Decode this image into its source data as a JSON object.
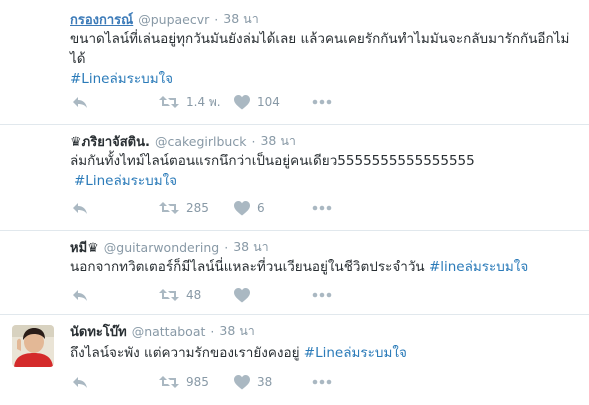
{
  "colors": {
    "hashtag": "#2b7bb9",
    "name_link": "#3b7ab8",
    "muted": "#8899a6",
    "icon": "#aab8c2",
    "divider": "#e1e8ed"
  },
  "icons": [
    "reply-icon",
    "retweet-icon",
    "like-icon",
    "more-icon"
  ],
  "tweets": [
    {
      "display_name": "กรองการณ์",
      "handle": "@pupaecvr",
      "sep": "·",
      "time": "38 นา",
      "text_line1": "ขนาดไลน์ที่เล่นอยู่ทุกวันมันยังล่มได้เลย แล้วคนเคยรักกันทำไมมันจะกลับมารักกันอีกไม่",
      "text_line2": "ได้",
      "hashtag": "#Lineล่มระบมใจ",
      "retweets": "1.4 พ.",
      "likes": "104"
    },
    {
      "display_name": "♛ภริยาจัสติน.",
      "handle": "@cakegirlbuck",
      "sep": "·",
      "time": "38 นา",
      "text": "ล่มกันทั้งไทม์ไลน์ตอนแรกนึกว่าเป็นอยู่คนเดียว5555555555555555",
      "hashtag": "#Lineล่มระบมใจ",
      "retweets": "285",
      "likes": "6"
    },
    {
      "display_name": "หมี♛",
      "handle": "@guitarwondering",
      "sep": "·",
      "time": "38 นา",
      "text": "นอกจากทวิตเตอร์ก็มีไลน์นี่แหละที่วนเวียนอยู่ในชีวิตประจำวัน ",
      "hashtag": "#lineล่มระบมใจ",
      "retweets": "48",
      "likes": ""
    },
    {
      "display_name": "นัดทะโบ๊ท",
      "handle": "@nattaboat",
      "sep": "·",
      "time": "38 นา",
      "text": "ถึงไลน์จะพัง แต่ความรักของเรายังคงอยู่ ",
      "hashtag": "#Lineล่มระบมใจ",
      "retweets": "985",
      "likes": "38"
    }
  ]
}
